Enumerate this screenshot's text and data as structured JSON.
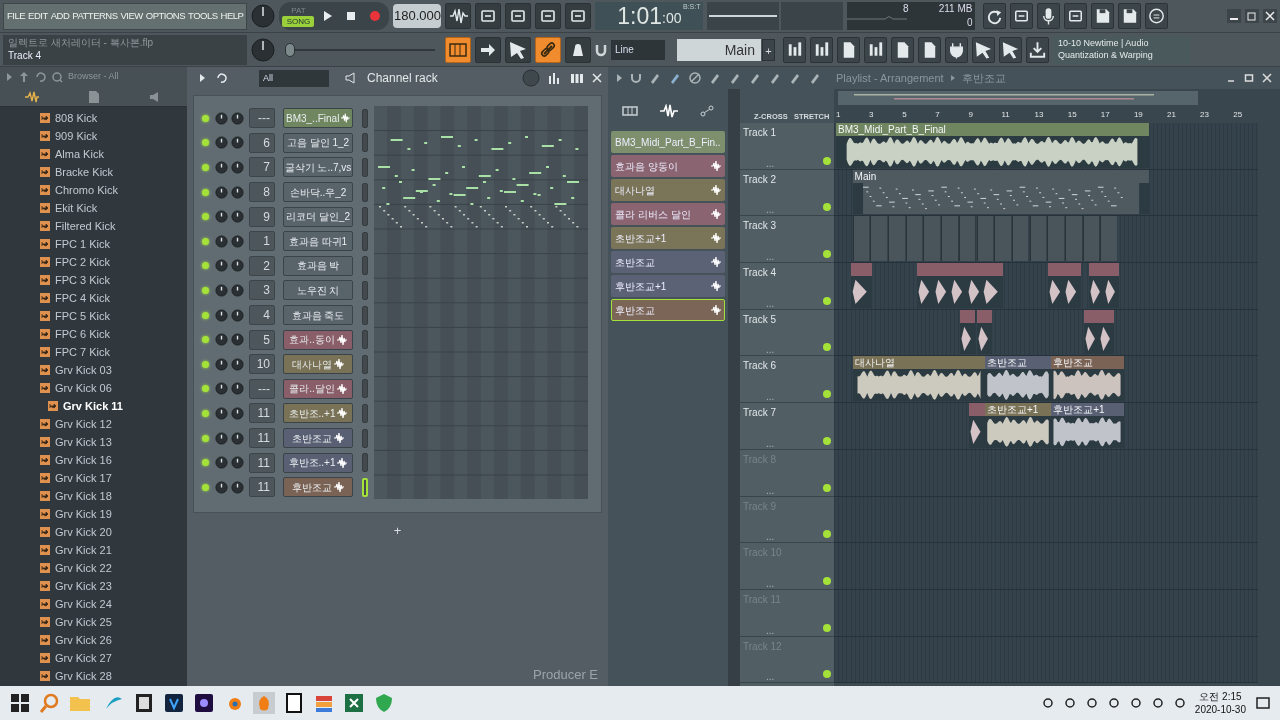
{
  "menu": [
    "FILE",
    "EDIT",
    "ADD",
    "PATTERNS",
    "VIEW",
    "OPTIONS",
    "TOOLS",
    "HELP"
  ],
  "transport": {
    "modes": [
      {
        "label": "PAT",
        "selected": false
      },
      {
        "label": "SONG",
        "selected": true
      }
    ],
    "tempo": "180.000",
    "time": "1:01",
    "ticks": ":00",
    "time_unit": "B:S:T"
  },
  "monitor": {
    "cpu": "8",
    "memory": "211 MB",
    "polyphony": "0"
  },
  "project": {
    "title": "일렉트로 새처레이터 - 복사본.flp",
    "hint": "Track 4"
  },
  "pitch": {
    "level": 0
  },
  "toggles": [
    {
      "on": true
    },
    {
      "on": false
    },
    {
      "on": false
    },
    {
      "on": true
    },
    {
      "on": false
    }
  ],
  "snap": "Line",
  "pattern": "Main",
  "pattern_add": "+",
  "hint_panel": {
    "line1": "10-10  Newtime | Audio",
    "line2": "Quantization & Warping"
  },
  "browser": {
    "title": "Browser - All",
    "items": [
      {
        "label": "808 Kick",
        "selected": false
      },
      {
        "label": "909 Kick",
        "selected": false
      },
      {
        "label": "Alma Kick",
        "selected": false
      },
      {
        "label": "Bracke Kick",
        "selected": false
      },
      {
        "label": "Chromo Kick",
        "selected": false
      },
      {
        "label": "Ekit Kick",
        "selected": false
      },
      {
        "label": "Filtered Kick",
        "selected": false
      },
      {
        "label": "FPC 1 Kick",
        "selected": false
      },
      {
        "label": "FPC 2 Kick",
        "selected": false
      },
      {
        "label": "FPC 3 Kick",
        "selected": false
      },
      {
        "label": "FPC 4 Kick",
        "selected": false
      },
      {
        "label": "FPC 5 Kick",
        "selected": false
      },
      {
        "label": "FPC 6 Kick",
        "selected": false
      },
      {
        "label": "FPC 7 Kick",
        "selected": false
      },
      {
        "label": "Grv Kick 03",
        "selected": false
      },
      {
        "label": "Grv Kick 06",
        "selected": false
      },
      {
        "label": "Grv Kick 11",
        "selected": true
      },
      {
        "label": "Grv Kick 12",
        "selected": false
      },
      {
        "label": "Grv Kick 13",
        "selected": false
      },
      {
        "label": "Grv Kick 16",
        "selected": false
      },
      {
        "label": "Grv Kick 17",
        "selected": false
      },
      {
        "label": "Grv Kick 18",
        "selected": false
      },
      {
        "label": "Grv Kick 19",
        "selected": false
      },
      {
        "label": "Grv Kick 20",
        "selected": false
      },
      {
        "label": "Grv Kick 21",
        "selected": false
      },
      {
        "label": "Grv Kick 22",
        "selected": false
      },
      {
        "label": "Grv Kick 23",
        "selected": false
      },
      {
        "label": "Grv Kick 24",
        "selected": false
      },
      {
        "label": "Grv Kick 25",
        "selected": false
      },
      {
        "label": "Grv Kick 26",
        "selected": false
      },
      {
        "label": "Grv Kick 27",
        "selected": false
      },
      {
        "label": "Grv Kick 28",
        "selected": false
      }
    ]
  },
  "channel_rack": {
    "filter": "All",
    "title": "Channel rack",
    "add": "+",
    "channels": [
      {
        "number": "---",
        "name": "BM3_..Final",
        "kind": "audio",
        "color": "#6f8660",
        "on": true,
        "selected": false
      },
      {
        "number": "6",
        "name": "고음 달인 1_2",
        "kind": "plain",
        "color": "#59636a",
        "on": true,
        "selected": false
      },
      {
        "number": "7",
        "name": "굴삭기 노..7,vs",
        "kind": "plain",
        "color": "#59636a",
        "on": true,
        "selected": false
      },
      {
        "number": "8",
        "name": "손바닥..우_2",
        "kind": "plain",
        "color": "#59636a",
        "on": true,
        "selected": false
      },
      {
        "number": "9",
        "name": "리코더 달인_2",
        "kind": "plain",
        "color": "#59636a",
        "on": true,
        "selected": false
      },
      {
        "number": "1",
        "name": "효과음 따귀1",
        "kind": "plain",
        "color": "#59636a",
        "on": true,
        "selected": false
      },
      {
        "number": "2",
        "name": "효과음 박",
        "kind": "plain",
        "color": "#59636a",
        "on": true,
        "selected": false
      },
      {
        "number": "3",
        "name": "노우진 치",
        "kind": "plain",
        "color": "#59636a",
        "on": true,
        "selected": false
      },
      {
        "number": "4",
        "name": "효과음 죽도",
        "kind": "plain",
        "color": "#59636a",
        "on": true,
        "selected": false
      },
      {
        "number": "5",
        "name": "효과..동이",
        "kind": "audio",
        "color": "#8a5e68",
        "on": true,
        "selected": false
      },
      {
        "number": "10",
        "name": "대사나열",
        "kind": "audio",
        "color": "#7a7256",
        "on": true,
        "selected": false
      },
      {
        "number": "---",
        "name": "콜라..달인",
        "kind": "audio",
        "color": "#8a5e68",
        "on": true,
        "selected": false
      },
      {
        "number": "11",
        "name": "초반조..+1",
        "kind": "audio",
        "color": "#7a7256",
        "on": true,
        "selected": false
      },
      {
        "number": "11",
        "name": "초반조교",
        "kind": "audio",
        "color": "#5a6074",
        "on": true,
        "selected": false
      },
      {
        "number": "11",
        "name": "후반조..+1",
        "kind": "audio",
        "color": "#5a6074",
        "on": true,
        "selected": false
      },
      {
        "number": "11",
        "name": "후반조교",
        "kind": "audio",
        "color": "#7a6254",
        "on": true,
        "selected": true
      }
    ]
  },
  "edition_label": "Producer E",
  "playlist": {
    "title": "Playlist - Arrangement",
    "pattern": "후반조교",
    "options": [
      "Z-CROSS",
      "STRETCH"
    ],
    "picker": [
      {
        "label": "BM3_Midi_Part_B_Fin..",
        "color": "#7d8f6c",
        "selected": false
      },
      {
        "label": "효과음 양동이",
        "color": "#8a6470",
        "selected": false
      },
      {
        "label": "대사나열",
        "color": "#7a7458",
        "selected": false
      },
      {
        "label": "콜라 리버스 달인",
        "color": "#8a6470",
        "selected": false
      },
      {
        "label": "초반조교+1",
        "color": "#7a7458",
        "selected": false
      },
      {
        "label": "초반조교",
        "color": "#5c6276",
        "selected": false
      },
      {
        "label": "후반조교+1",
        "color": "#5c6276",
        "selected": false
      },
      {
        "label": "후반조교",
        "color": "#7a6556",
        "selected": true
      }
    ],
    "ruler": [
      "1",
      "3",
      "5",
      "7",
      "9",
      "11",
      "13",
      "15",
      "17",
      "19",
      "21",
      "23",
      "25"
    ],
    "tracks": [
      {
        "name": "Track 1",
        "dots": "...",
        "dimmed": false,
        "clips": [
          {
            "kind": "audio",
            "label": "BM3_Midi_Part_B_Final",
            "color": "#6f8660"
          }
        ]
      },
      {
        "name": "Track 2",
        "dots": "...",
        "dimmed": false,
        "clips": [
          {
            "kind": "pattern",
            "label": "Main",
            "color": "#4f5a60"
          }
        ]
      },
      {
        "name": "Track 3",
        "dots": "...",
        "dimmed": false,
        "clips": [
          {
            "kind": "block",
            "color": "#4a555b"
          },
          {
            "kind": "block",
            "color": "#4a555b"
          },
          {
            "kind": "block",
            "color": "#4a555b"
          },
          {
            "kind": "block",
            "color": "#4a555b"
          },
          {
            "kind": "block",
            "color": "#4a555b"
          },
          {
            "kind": "block",
            "color": "#4a555b"
          },
          {
            "kind": "block",
            "color": "#4a555b"
          },
          {
            "kind": "block",
            "color": "#4a555b"
          },
          {
            "kind": "block",
            "color": "#4a555b"
          },
          {
            "kind": "block",
            "color": "#4a555b"
          },
          {
            "kind": "block",
            "color": "#4a555b"
          },
          {
            "kind": "block",
            "color": "#4a555b"
          },
          {
            "kind": "block",
            "color": "#4a555b"
          },
          {
            "kind": "block",
            "color": "#4a555b"
          },
          {
            "kind": "block",
            "color": "#4a555b"
          }
        ]
      },
      {
        "name": "Track 4",
        "dots": "...",
        "dimmed": false,
        "clips": [
          {
            "kind": "sample",
            "color": "#8a5e68"
          },
          {
            "kind": "sample",
            "color": "#8a5e68"
          },
          {
            "kind": "sample",
            "color": "#8a5e68"
          },
          {
            "kind": "sample",
            "color": "#8a5e68"
          },
          {
            "kind": "sample",
            "color": "#8a5e68"
          },
          {
            "kind": "sample",
            "color": "#8a5e68"
          },
          {
            "kind": "sample",
            "color": "#8a5e68"
          },
          {
            "kind": "sample",
            "color": "#8a5e68"
          },
          {
            "kind": "sample",
            "color": "#8a5e68"
          },
          {
            "kind": "sample",
            "color": "#8a5e68"
          }
        ]
      },
      {
        "name": "Track 5",
        "dots": "...",
        "dimmed": false,
        "clips": [
          {
            "kind": "sample",
            "color": "#8a5e68"
          },
          {
            "kind": "sample",
            "color": "#8a5e68"
          },
          {
            "kind": "sample",
            "color": "#8a5e68"
          },
          {
            "kind": "sample",
            "color": "#8a5e68"
          }
        ]
      },
      {
        "name": "Track 6",
        "dots": "...",
        "dimmed": false,
        "clips": [
          {
            "kind": "audio",
            "label": "대사나열",
            "color": "#7a7256"
          },
          {
            "kind": "audio",
            "label": "초반조교",
            "color": "#5a6074"
          },
          {
            "kind": "audio",
            "label": "후반조교",
            "color": "#7a6254"
          }
        ]
      },
      {
        "name": "Track 7",
        "dots": "...",
        "dimmed": false,
        "clips": [
          {
            "kind": "sample",
            "color": "#8a5e68"
          },
          {
            "kind": "audio",
            "label": "초반조교+1",
            "color": "#7a7256"
          },
          {
            "kind": "audio",
            "label": "후반조교+1",
            "color": "#5a6074"
          }
        ]
      },
      {
        "name": "Track 8",
        "dots": "...",
        "dimmed": true
      },
      {
        "name": "Track 9",
        "dots": "...",
        "dimmed": true
      },
      {
        "name": "Track 10",
        "dots": "...",
        "dimmed": true
      },
      {
        "name": "Track 11",
        "dots": "...",
        "dimmed": true
      },
      {
        "name": "Track 12",
        "dots": "...",
        "dimmed": true
      }
    ]
  },
  "taskbar": {
    "time": "오전 2:15",
    "date": "2020-10-30"
  }
}
